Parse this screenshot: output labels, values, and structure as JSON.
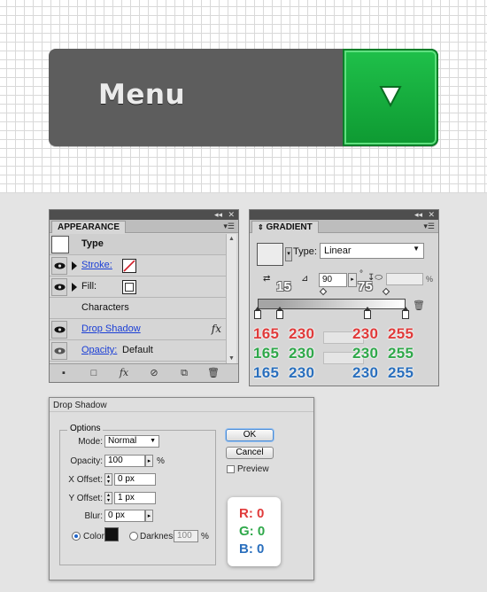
{
  "button_preview": {
    "label": "Menu",
    "arrow_icon": "down-triangle-icon",
    "colors": {
      "body": "#5d5d5d",
      "accent": "#13ad3e"
    }
  },
  "appearance": {
    "tab": "APPEARANCE",
    "header_label": "Type",
    "rows": [
      {
        "label": "Stroke:",
        "swatch": "none"
      },
      {
        "label": "Fill:",
        "swatch": "white"
      },
      {
        "label": "Characters"
      },
      {
        "label": "Drop Shadow",
        "fx": "fx"
      },
      {
        "label": "Opacity:",
        "value": "Default"
      }
    ],
    "footer_fx": "fx"
  },
  "gradient": {
    "tab": "GRADIENT",
    "type_label": "Type:",
    "type_value": "Linear",
    "angle_value": "90",
    "degree_symbol": "°",
    "percent_symbol": "%",
    "annot_left": "15",
    "annot_right": "75",
    "rgb": [
      {
        "channel": "R",
        "values": [
          "165",
          "230",
          "230",
          "255"
        ]
      },
      {
        "channel": "G",
        "values": [
          "165",
          "230",
          "230",
          "255"
        ]
      },
      {
        "channel": "B",
        "values": [
          "165",
          "230",
          "230",
          "255"
        ]
      }
    ]
  },
  "drop_shadow": {
    "title": "Drop Shadow",
    "group": "Options",
    "mode_label": "Mode:",
    "mode_value": "Normal",
    "opacity_label": "Opacity:",
    "opacity_value": "100",
    "opacity_unit": "%",
    "xoffset_label": "X Offset:",
    "xoffset_value": "0 px",
    "yoffset_label": "Y Offset:",
    "yoffset_value": "1 px",
    "blur_label": "Blur:",
    "blur_value": "0 px",
    "color_label": "Color:",
    "darkness_label": "Darkness:",
    "darkness_value": "100",
    "darkness_unit": "%",
    "ok_label": "OK",
    "cancel_label": "Cancel",
    "preview_label": "Preview",
    "color_rgb": {
      "r": "R: 0",
      "g": "G: 0",
      "b": "B: 0"
    }
  }
}
